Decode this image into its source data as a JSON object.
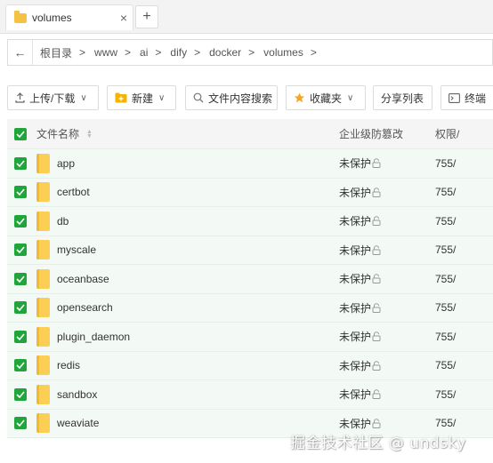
{
  "tab": {
    "title": "volumes",
    "close_glyph": "×"
  },
  "new_tab_glyph": "+",
  "address": {
    "back_glyph": "←",
    "crumbs": [
      "根目录",
      "www",
      "ai",
      "dify",
      "docker",
      "volumes"
    ],
    "sep": ">"
  },
  "toolbar": {
    "upload": "上传/下载",
    "new": "新建",
    "search": "文件内容搜索",
    "favorites": "收藏夹",
    "share": "分享列表",
    "terminal": "终端",
    "chevron": "∨"
  },
  "table": {
    "headers": {
      "name": "文件名称",
      "protect": "企业级防篡改",
      "perm": "权限/"
    },
    "rows": [
      {
        "name": "app",
        "protect": "未保护",
        "perm": "755/"
      },
      {
        "name": "certbot",
        "protect": "未保护",
        "perm": "755/"
      },
      {
        "name": "db",
        "protect": "未保护",
        "perm": "755/"
      },
      {
        "name": "myscale",
        "protect": "未保护",
        "perm": "755/"
      },
      {
        "name": "oceanbase",
        "protect": "未保护",
        "perm": "755/"
      },
      {
        "name": "opensearch",
        "protect": "未保护",
        "perm": "755/"
      },
      {
        "name": "plugin_daemon",
        "protect": "未保护",
        "perm": "755/"
      },
      {
        "name": "redis",
        "protect": "未保护",
        "perm": "755/"
      },
      {
        "name": "sandbox",
        "protect": "未保护",
        "perm": "755/"
      },
      {
        "name": "weaviate",
        "protect": "未保护",
        "perm": "755/"
      }
    ]
  },
  "watermark": "掘金技术社区 @ undsky",
  "colors": {
    "accent": "#20a53a",
    "row_bg": "#f3faf6",
    "folder": "#fbcf54"
  }
}
